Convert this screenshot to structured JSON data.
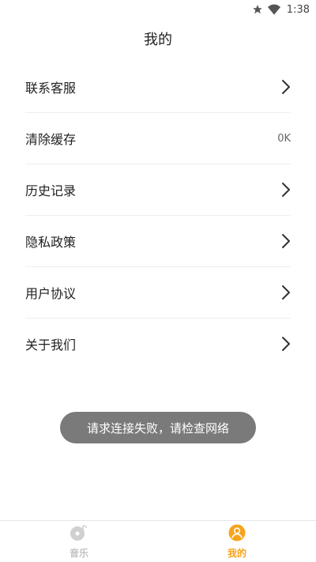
{
  "status_bar": {
    "time": "1:38",
    "icons": [
      "star-icon",
      "wifi-icon"
    ]
  },
  "header": {
    "title": "我的"
  },
  "menu": {
    "items": [
      {
        "label": "联系客服",
        "value": "",
        "icon": "chevron-right-icon"
      },
      {
        "label": "清除缓存",
        "value": "0K",
        "icon": ""
      },
      {
        "label": "历史记录",
        "value": "",
        "icon": "chevron-right-icon"
      },
      {
        "label": "隐私政策",
        "value": "",
        "icon": "chevron-right-icon"
      },
      {
        "label": "用户协议",
        "value": "",
        "icon": "chevron-right-icon"
      },
      {
        "label": "关于我们",
        "value": "",
        "icon": "chevron-right-icon"
      }
    ]
  },
  "toast": {
    "message": "请求连接失败，请检查网络"
  },
  "tab_bar": {
    "tabs": [
      {
        "label": "音乐",
        "icon": "music-disc-icon",
        "active": false
      },
      {
        "label": "我的",
        "icon": "user-icon",
        "active": true
      }
    ]
  },
  "colors": {
    "accent": "#f6a41c",
    "inactive_tab": "#c2c2c2",
    "toast_bg": "#7a7a7a",
    "divider": "#eeeeee"
  }
}
